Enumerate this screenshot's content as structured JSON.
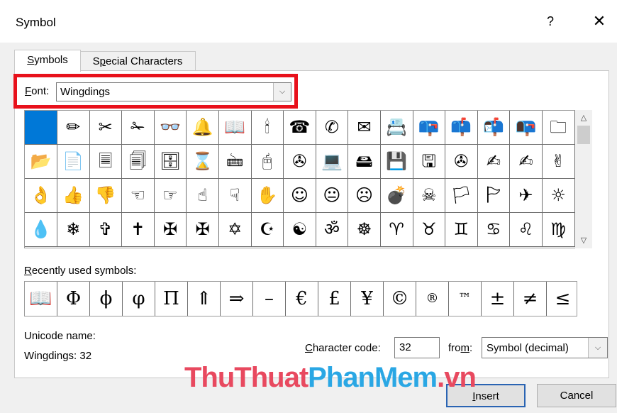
{
  "window": {
    "title": "Symbol",
    "help": "?",
    "close": "✕"
  },
  "tabs": [
    {
      "label": "Symbols",
      "underline": "S",
      "rest": "ymbols"
    },
    {
      "label": "Special Characters",
      "pre": "S",
      "underline": "p",
      "rest": "ecial Characters"
    }
  ],
  "font": {
    "label_u": "F",
    "label_rest": "ont:",
    "value": "Wingdings"
  },
  "symbols": [
    " ",
    "✏",
    "✂",
    "✁",
    "👓",
    "🔔",
    "📖",
    "🕯",
    "☎",
    "✆",
    "✉",
    "📇",
    "📪",
    "📫",
    "📬",
    "📭",
    "🗀",
    "📂",
    "📄",
    "🗏",
    "🗐",
    "🗄",
    "⌛",
    "🖮",
    "🖰",
    "✇",
    "💻",
    "🖴",
    "💾",
    "🖫",
    "✇",
    "✍",
    "✍",
    "✌",
    "👌",
    "👍",
    "👎",
    "☜",
    "☞",
    "☝",
    "☟",
    "✋",
    "☺",
    "😐",
    "☹",
    "💣",
    "☠",
    "🏳",
    "🏱",
    "✈",
    "☼",
    "💧",
    "❄",
    "✞",
    "✝",
    "✠",
    "✠",
    "✡",
    "☪",
    "☯",
    "ॐ",
    "☸",
    "♈",
    "♉",
    "♊",
    "♋",
    "♌",
    "♍"
  ],
  "recent": {
    "label_u": "R",
    "label_rest": "ecently used symbols:",
    "items": [
      "📖",
      "Φ",
      "ϕ",
      "φ",
      "Π",
      "⇑",
      "⇒",
      "–",
      "€",
      "£",
      "¥",
      "©",
      "®",
      "™",
      "±",
      "≠",
      "≤"
    ]
  },
  "unicode": {
    "label": "Unicode name:",
    "value": "Wingdings: 32"
  },
  "character_code": {
    "label_u": "C",
    "label_rest": "haracter code:",
    "value": "32"
  },
  "from": {
    "label_pre": "fro",
    "label_u": "m",
    "label_post": ":",
    "value": "Symbol (decimal)"
  },
  "watermark": {
    "part1": "ThuThuat",
    "part2": "PhanMem",
    "part3": ".vn"
  },
  "buttons": {
    "insert_u": "I",
    "insert_rest": "nsert",
    "cancel": "Cancel"
  },
  "icons": {
    "dropdown": "chevron-down-icon",
    "scroll_up": "chevron-up-icon",
    "scroll_down": "chevron-down-icon"
  }
}
